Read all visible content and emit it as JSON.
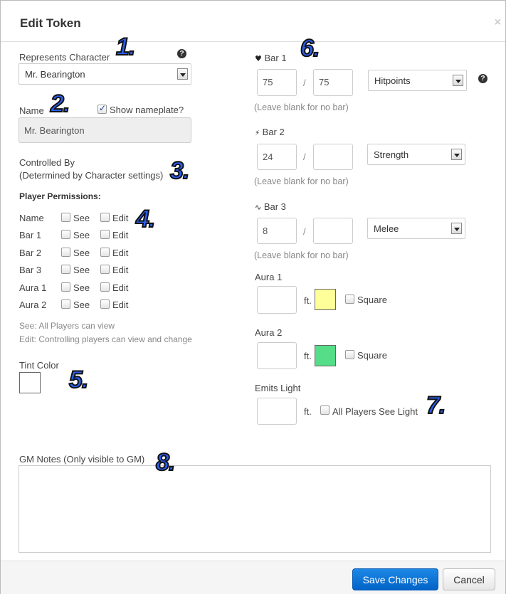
{
  "dialog": {
    "title": "Edit Token",
    "close": "×"
  },
  "represents": {
    "label": "Represents Character",
    "value": "Mr. Bearington",
    "help": "?"
  },
  "name": {
    "label": "Name",
    "show_nameplate": "Show nameplate?",
    "value": "Mr. Bearington",
    "show_checked": true
  },
  "controlled": {
    "line1": "Controlled By",
    "line2": "(Determined by Character settings)"
  },
  "permissions": {
    "heading": "Player Permissions:",
    "see": "See",
    "edit": "Edit",
    "rows": [
      "Name",
      "Bar 1",
      "Bar 2",
      "Bar 3",
      "Aura 1",
      "Aura 2"
    ],
    "note1": "See: All Players can view",
    "note2": "Edit: Controlling players can view and change"
  },
  "tint": {
    "label": "Tint Color",
    "color": "#ffffff"
  },
  "bars": {
    "slash": "/",
    "blank_note": "(Leave blank for no bar)",
    "help": "?",
    "bar1": {
      "label": "Bar 1",
      "icon": "heart-icon",
      "value": "75",
      "max": "75",
      "link": "Hitpoints"
    },
    "bar2": {
      "label": "Bar 2",
      "icon": "bolt-icon",
      "value": "24",
      "max": "",
      "link": "Strength"
    },
    "bar3": {
      "label": "Bar 3",
      "icon": "pulse-icon",
      "value": "8",
      "max": "",
      "link": "Melee"
    }
  },
  "aura1": {
    "label": "Aura 1",
    "unit": "ft.",
    "square": "Square",
    "color": "#ffff99"
  },
  "aura2": {
    "label": "Aura 2",
    "unit": "ft.",
    "square": "Square",
    "color": "#55dd88"
  },
  "light": {
    "label": "Emits Light",
    "unit": "ft.",
    "all_players": "All Players See Light"
  },
  "gm_notes": {
    "label": "GM Notes (Only visible to GM)"
  },
  "footer": {
    "save": "Save Changes",
    "cancel": "Cancel"
  },
  "annotations": [
    "1.",
    "2.",
    "3.",
    "4.",
    "5.",
    "6.",
    "7.",
    "8."
  ]
}
